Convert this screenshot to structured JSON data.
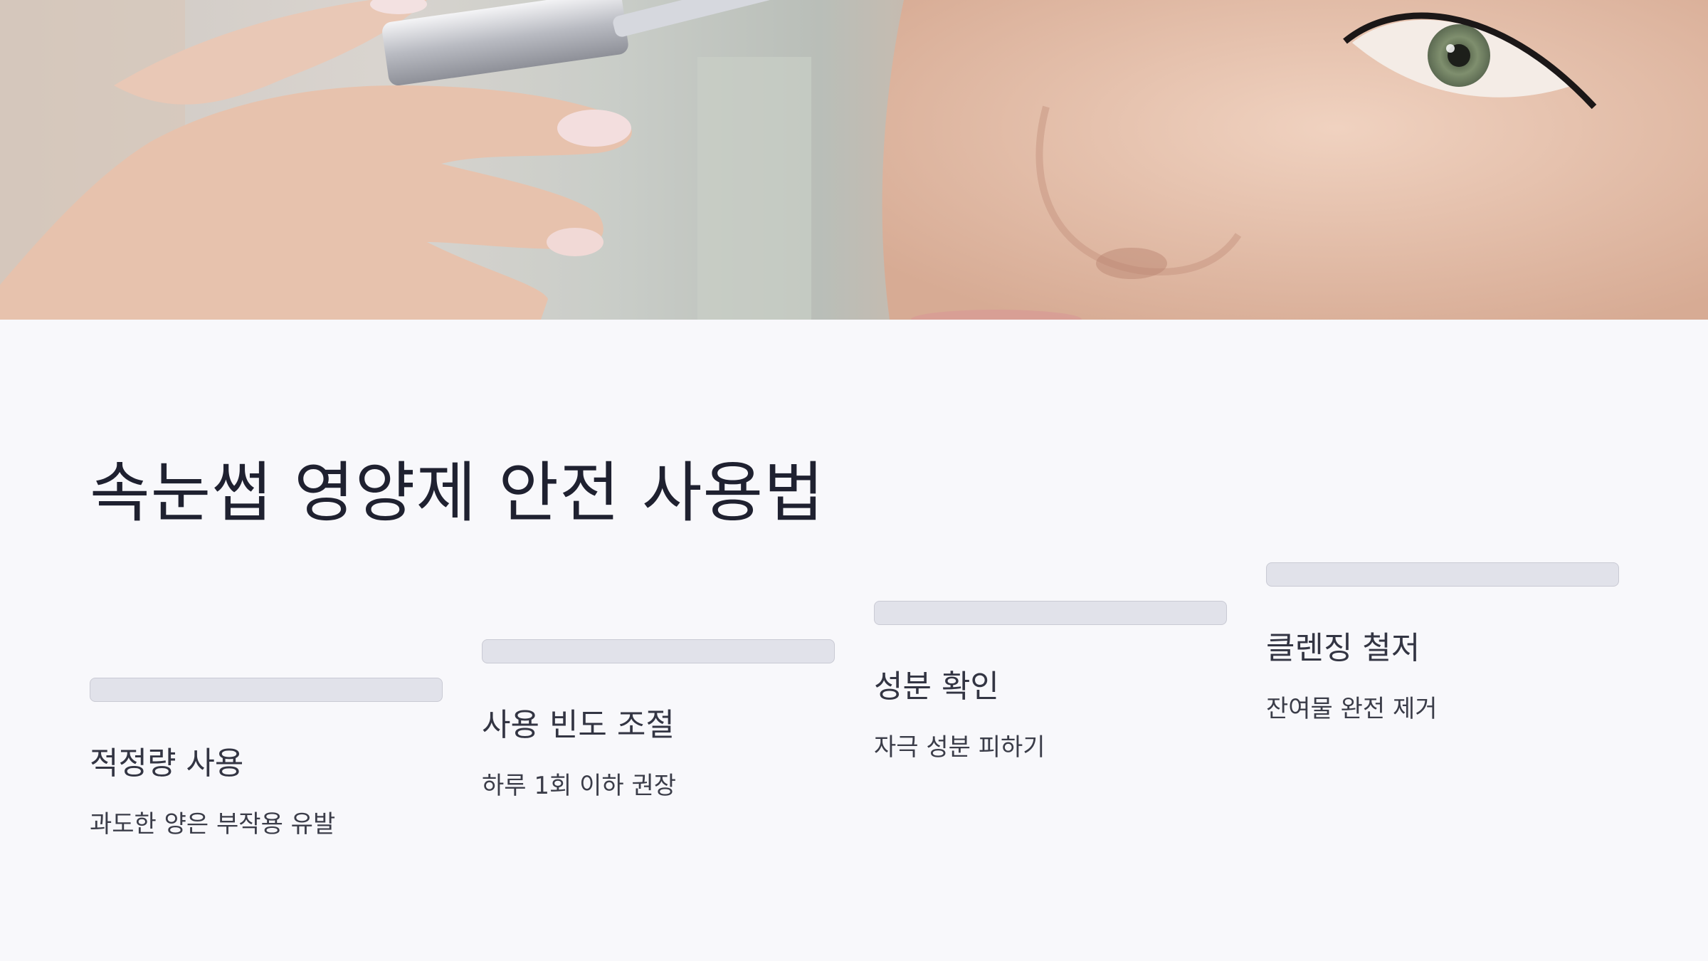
{
  "hero": {
    "image": "hand-holding-serum-dropper-near-eye"
  },
  "title": "속눈썹 영양제 안전 사용법",
  "steps": [
    {
      "heading": "적정량 사용",
      "description": "과도한 양은 부작용 유발"
    },
    {
      "heading": "사용 빈도 조절",
      "description": "하루 1회 이하 권장"
    },
    {
      "heading": "성분 확인",
      "description": "자극 성분 피하기"
    },
    {
      "heading": "클렌징 철저",
      "description": "잔여물 완전 제거"
    }
  ],
  "colors": {
    "background": "#f8f8fb",
    "bar": "#e1e2ea",
    "title": "#1f2130"
  }
}
